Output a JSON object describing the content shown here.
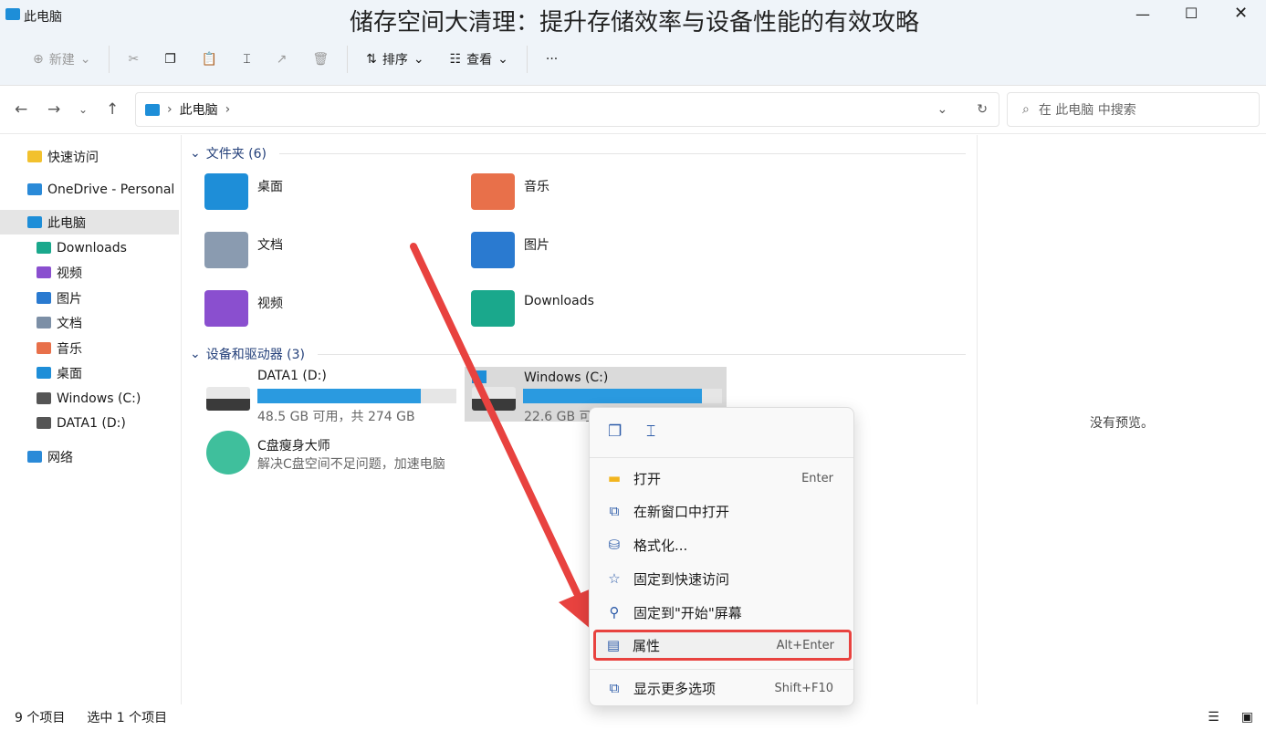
{
  "window": {
    "title": "此电脑",
    "overlay_heading": "储存空间大清理：提升存储效率与设备性能的有效攻略"
  },
  "toolbar": {
    "new": "新建",
    "sort": "排序",
    "view": "查看",
    "more": "···"
  },
  "address": {
    "path": "此电脑",
    "search_placeholder": "在 此电脑 中搜索"
  },
  "sidebar": {
    "items": [
      {
        "label": "快速访问",
        "icon": "star-icon",
        "color": "#f2c12e"
      },
      {
        "label": "OneDrive - Personal",
        "icon": "cloud-icon",
        "color": "#2a8ad8"
      },
      {
        "label": "此电脑",
        "icon": "computer-icon",
        "color": "#1e8ed8",
        "selected": true
      },
      {
        "label": "Downloads",
        "icon": "downloads-icon",
        "color": "#1aa88c"
      },
      {
        "label": "视频",
        "icon": "video-icon",
        "color": "#8a4fcf"
      },
      {
        "label": "图片",
        "icon": "pictures-icon",
        "color": "#2a7ad0"
      },
      {
        "label": "文档",
        "icon": "documents-icon",
        "color": "#7c8fa6"
      },
      {
        "label": "音乐",
        "icon": "music-icon",
        "color": "#e8704a"
      },
      {
        "label": "桌面",
        "icon": "desktop-icon",
        "color": "#1e8ed8"
      },
      {
        "label": "Windows (C:)",
        "icon": "drive-icon",
        "color": "#555555"
      },
      {
        "label": "DATA1 (D:)",
        "icon": "drive-icon",
        "color": "#555555"
      },
      {
        "label": "网络",
        "icon": "network-icon",
        "color": "#2a8ad8"
      }
    ]
  },
  "folders": {
    "header": "文件夹 (6)",
    "items": [
      {
        "label": "桌面",
        "color": "#1e8ed8"
      },
      {
        "label": "音乐",
        "color": "#e8704a"
      },
      {
        "label": "文档",
        "color": "#8a9bb0"
      },
      {
        "label": "图片",
        "color": "#2a7ad0"
      },
      {
        "label": "视频",
        "color": "#8a4fcf"
      },
      {
        "label": "Downloads",
        "color": "#1aa88c"
      }
    ]
  },
  "devices": {
    "header": "设备和驱动器 (3)",
    "drives": [
      {
        "name": "DATA1 (D:)",
        "free": "48.5 GB 可用，共 274 GB",
        "used_fraction": 0.823
      },
      {
        "name": "Windows (C:)",
        "free": "22.6 GB 可",
        "used_fraction": 0.9
      }
    ],
    "app": {
      "name": "C盘瘦身大师",
      "desc": "解决C盘空间不足问题，加速电脑"
    }
  },
  "preview": {
    "text": "没有预览。"
  },
  "status": {
    "count": "9 个项目",
    "selected": "选中 1 个项目"
  },
  "context_menu": {
    "items": [
      {
        "label": "打开",
        "shortcut": "Enter",
        "icon": "folder-open-icon"
      },
      {
        "label": "在新窗口中打开",
        "shortcut": "",
        "icon": "new-window-icon"
      },
      {
        "label": "格式化...",
        "shortcut": "",
        "icon": "format-icon"
      },
      {
        "label": "固定到快速访问",
        "shortcut": "",
        "icon": "star-outline-icon"
      },
      {
        "label": "固定到\"开始\"屏幕",
        "shortcut": "",
        "icon": "pin-icon"
      },
      {
        "label": "属性",
        "shortcut": "Alt+Enter",
        "icon": "properties-icon",
        "highlighted": true
      },
      {
        "label": "显示更多选项",
        "shortcut": "Shift+F10",
        "icon": "more-options-icon"
      }
    ]
  },
  "colors": {
    "accent": "#2a9ae0",
    "annotation": "#e8423f"
  }
}
